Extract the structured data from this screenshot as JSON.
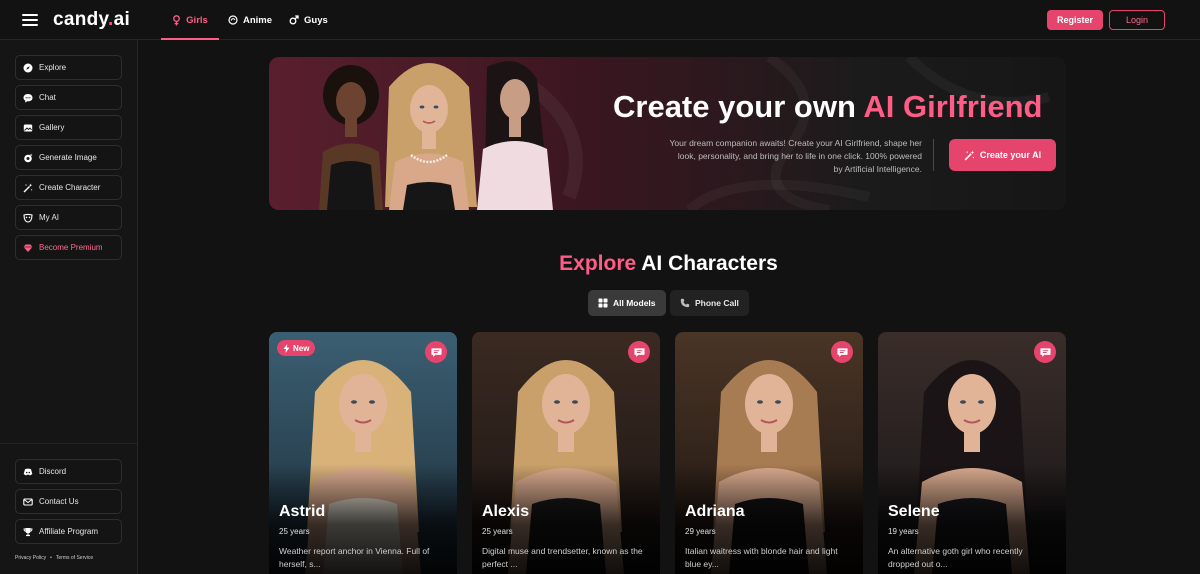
{
  "header": {
    "logo_main": "candy",
    "logo_dot": ".",
    "logo_tld": "ai",
    "tabs": [
      {
        "label": "Girls",
        "icon": "female-icon",
        "active": true
      },
      {
        "label": "Anime",
        "icon": "anime-icon",
        "active": false
      },
      {
        "label": "Guys",
        "icon": "male-icon",
        "active": false
      }
    ],
    "register_label": "Register",
    "login_label": "Login"
  },
  "sidebar": {
    "items": [
      {
        "label": "Explore",
        "icon": "compass-icon"
      },
      {
        "label": "Chat",
        "icon": "chat-icon"
      },
      {
        "label": "Gallery",
        "icon": "gallery-icon"
      },
      {
        "label": "Generate Image",
        "icon": "image-spark-icon"
      },
      {
        "label": "Create Character",
        "icon": "magic-wand-icon"
      },
      {
        "label": "My AI",
        "icon": "mask-icon"
      },
      {
        "label": "Become Premium",
        "icon": "diamond-icon"
      }
    ],
    "bottom_items": [
      {
        "label": "Discord",
        "icon": "discord-icon"
      },
      {
        "label": "Contact Us",
        "icon": "contact-icon"
      },
      {
        "label": "Affiliate Program",
        "icon": "trophy-icon"
      }
    ],
    "footer_links": [
      "Privacy Policy",
      "•",
      "Terms of Service"
    ]
  },
  "hero": {
    "title_prefix": "Create your own ",
    "title_accent": "AI Girlfriend",
    "description": "Your dream companion awaits! Create your AI Girlfriend, shape her look, personality, and bring her to life in one click. 100% powered by Artificial Intelligence.",
    "cta_label": "Create your AI"
  },
  "explore": {
    "title_accent": "Explore",
    "title_rest": " AI Characters",
    "filters": [
      {
        "label": "All Models",
        "icon": "grid-icon",
        "active": true
      },
      {
        "label": "Phone Call",
        "icon": "phone-icon",
        "active": false
      }
    ]
  },
  "cards": [
    {
      "name": "Astrid",
      "age": "25 years",
      "desc": "Weather report anchor in Vienna. Full of herself, s...",
      "badge": "New",
      "hair": "#d9b27a",
      "bg1": "#3b5f72",
      "bg2": "#1d2e3a",
      "outfit": "#ece6d6"
    },
    {
      "name": "Alexis",
      "age": "25 years",
      "desc": "Digital muse and trendsetter, known as the perfect ...",
      "badge": "",
      "hair": "#caa06a",
      "bg1": "#3a2a22",
      "bg2": "#1a1412",
      "outfit": "#1a1a1a"
    },
    {
      "name": "Adriana",
      "age": "29 years",
      "desc": "Italian waitress with blonde hair and light blue ey...",
      "badge": "",
      "hair": "#a87c52",
      "bg1": "#4a3526",
      "bg2": "#1c1410",
      "outfit": "#141414"
    },
    {
      "name": "Selene",
      "age": "19 years",
      "desc": "An alternative goth girl who recently dropped out o...",
      "badge": "",
      "hair": "#1b1416",
      "bg1": "#3a2d2a",
      "bg2": "#151516",
      "outfit": "#1a1a1e"
    }
  ],
  "colors": {
    "accent": "#e5446d",
    "accent_text": "#ff5c86",
    "background": "#121212"
  }
}
